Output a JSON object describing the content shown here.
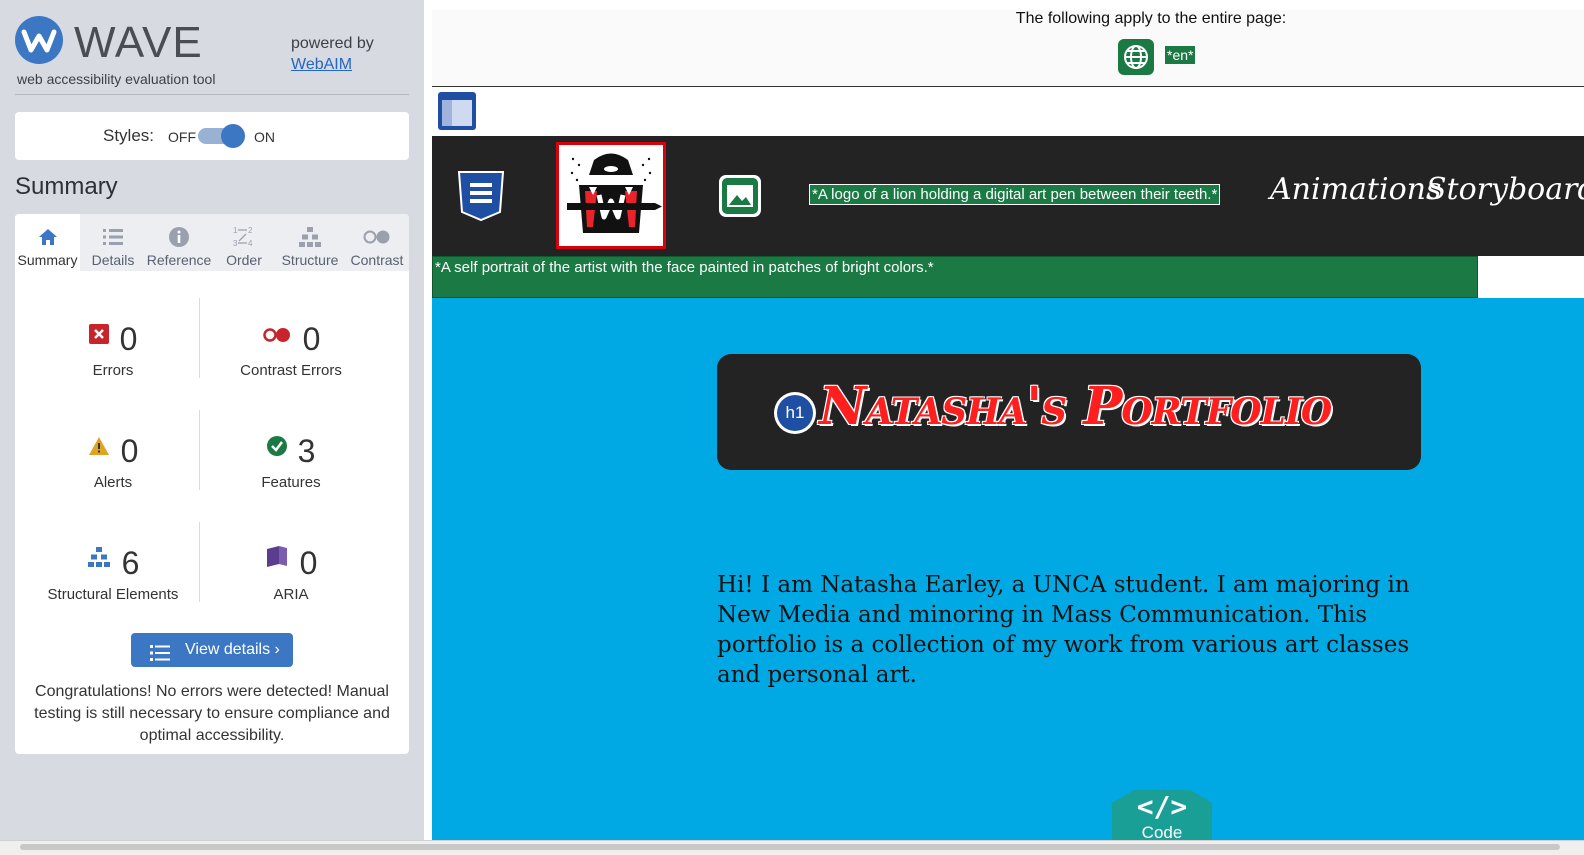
{
  "sidebar": {
    "app_title": "WAVE",
    "app_subtitle": "web accessibility evaluation tool",
    "powered_by": "powered by",
    "powered_link": "WebAIM",
    "styles": {
      "label": "Styles:",
      "off": "OFF",
      "on": "ON",
      "state": "on"
    },
    "summary_heading": "Summary",
    "tabs": [
      {
        "label": "Summary",
        "icon": "home-icon",
        "active": true
      },
      {
        "label": "Details",
        "icon": "list-icon",
        "active": false
      },
      {
        "label": "Reference",
        "icon": "info-icon",
        "active": false
      },
      {
        "label": "Order",
        "icon": "order-icon",
        "active": false
      },
      {
        "label": "Structure",
        "icon": "structure-icon",
        "active": false
      },
      {
        "label": "Contrast",
        "icon": "contrast-icon",
        "active": false
      }
    ],
    "counts": {
      "errors": {
        "value": "0",
        "label": "Errors",
        "icon": "error-icon",
        "color": "#c8242b"
      },
      "contrast_errors": {
        "value": "0",
        "label": "Contrast Errors",
        "icon": "contrast-error-icon",
        "color": "#c8242b"
      },
      "alerts": {
        "value": "0",
        "label": "Alerts",
        "icon": "alert-icon",
        "color": "#e0a424"
      },
      "features": {
        "value": "3",
        "label": "Features",
        "icon": "feature-icon",
        "color": "#1b7a44"
      },
      "structural": {
        "value": "6",
        "label": "Structural Elements",
        "icon": "structure-icon",
        "color": "#3c77c4"
      },
      "aria": {
        "value": "0",
        "label": "ARIA",
        "icon": "aria-icon",
        "color": "#5b3c8f"
      }
    },
    "view_details": "View details ›",
    "congrats": "Congratulations! No errors were detected! Manual testing is still necessary to ensure compliance and optimal accessibility."
  },
  "page": {
    "entire_page_text": "The following apply to the entire page:",
    "lang_tag": "*en*",
    "alt_logo": "*A logo of a lion holding a digital art pen between their teeth.*",
    "nav_links": [
      "Animations",
      "Storyboards"
    ],
    "alt_portrait": "*A self portrait of the artist with the face painted in patches of bright colors.*",
    "h1_badge": "h1",
    "title": "Natasha's Portfolio",
    "intro": "Hi! I am Natasha Earley, a UNCA student. I am majoring in New Media and minoring in Mass Communication. This portfolio is a collection of my work from various art classes and personal art.",
    "code_badge": {
      "glyph": "</>",
      "label": "Code"
    }
  },
  "colors": {
    "wave_blue": "#3c77c4",
    "sidebar_bg": "#d7dae1",
    "feature_green": "#1b7a44",
    "nav_bg": "#232323",
    "hero_bg": "#00a9e3",
    "title_red": "#ff1f1f",
    "code_teal": "#1a9f97"
  }
}
